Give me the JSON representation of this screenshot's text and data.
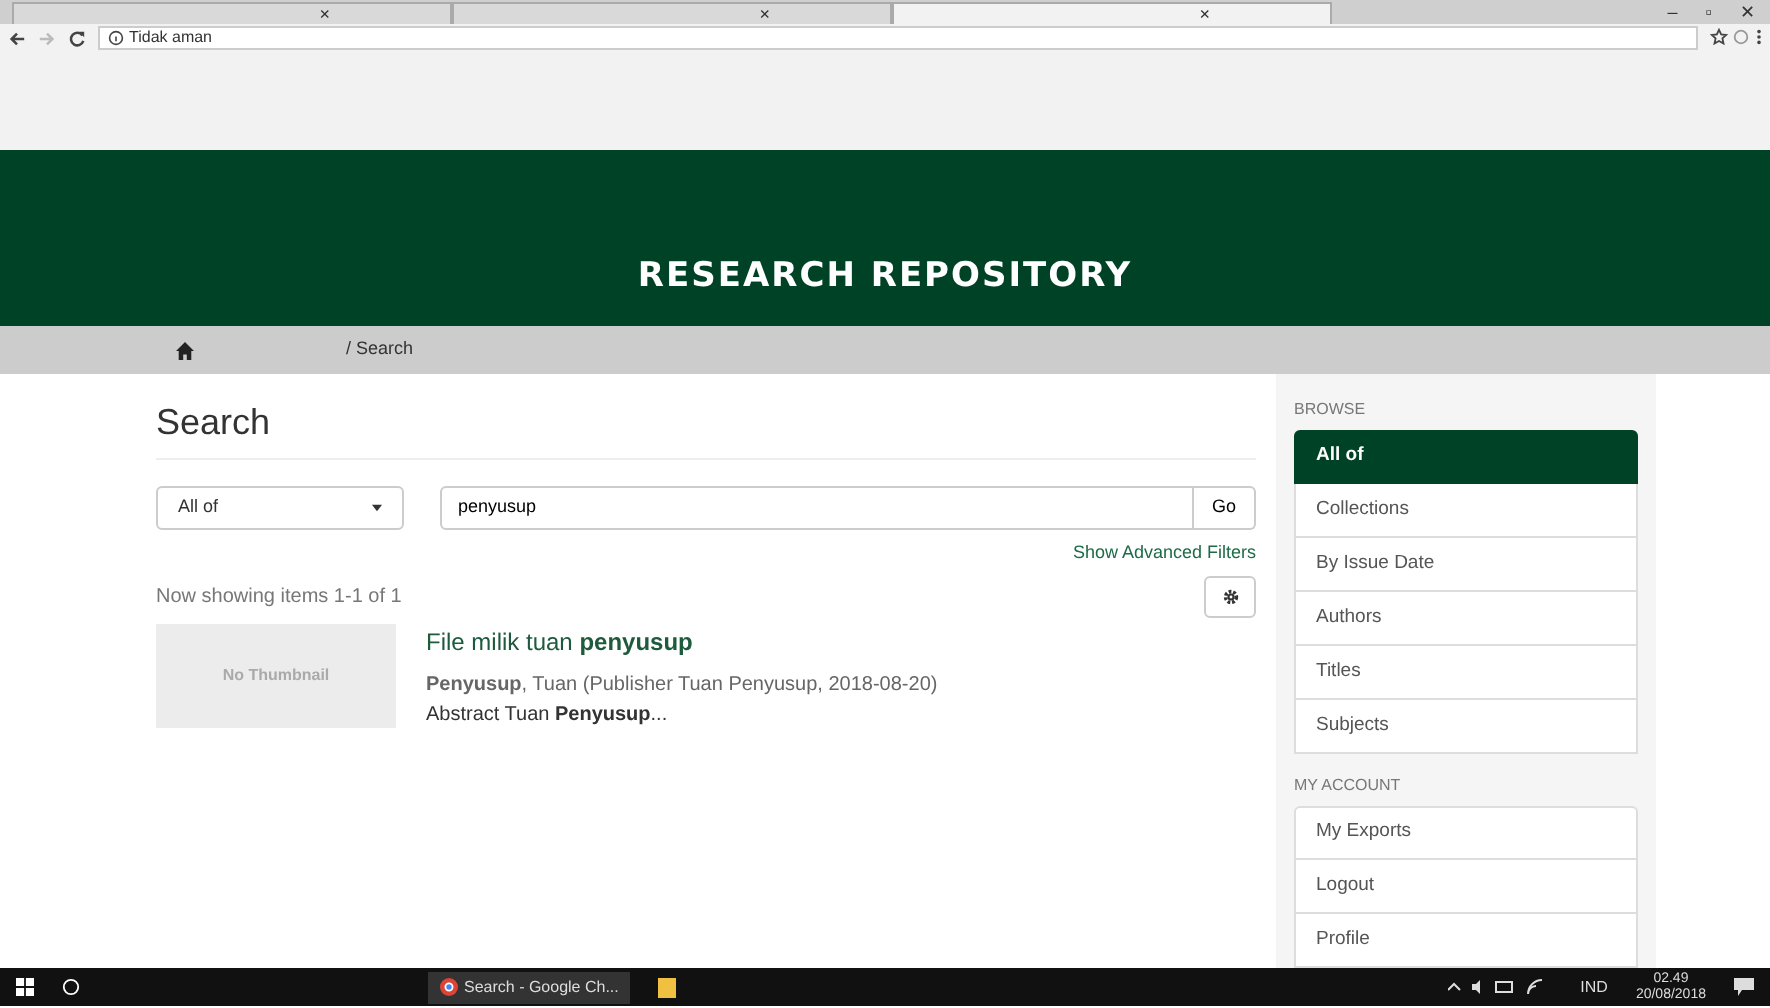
{
  "browser": {
    "tabs": [
      {
        "label": "×",
        "selected": false
      },
      {
        "label": "×",
        "selected": false
      },
      {
        "label": "×",
        "selected": true
      }
    ],
    "window_buttons": [
      "–",
      "▫",
      "✕"
    ],
    "address": "Tidak aman"
  },
  "banner": {
    "title": "RESEARCH REPOSITORY"
  },
  "breadcrumb": [
    "/ Search"
  ],
  "page_title": "Search",
  "search": {
    "scope": "All of",
    "query": "penyusup",
    "go": "Go",
    "advanced": "Show Advanced Filters"
  },
  "results": {
    "count": "Now showing items 1-1 of 1",
    "items": [
      {
        "thumbnail": "No Thumbnail",
        "title": "File milik tuan **penyusup**",
        "meta": "**Penyusup**, Tuan (Publisher Tuan Penyusup, 2018-08-20)",
        "abstract": "Abstract Tuan **Penyusup**..."
      }
    ]
  },
  "sidebar": {
    "sections": [
      {
        "heading": "BROWSE",
        "items": [
          {
            "label": "All of",
            "selected": true
          },
          {
            "label": "Collections",
            "selected": false
          },
          {
            "label": "By Issue Date",
            "selected": false
          },
          {
            "label": "Authors",
            "selected": false
          },
          {
            "label": "Titles",
            "selected": false
          },
          {
            "label": "Subjects",
            "selected": false
          }
        ]
      },
      {
        "heading": "MY ACCOUNT",
        "items": [
          {
            "label": "My Exports",
            "selected": false
          },
          {
            "label": "Logout",
            "selected": false
          },
          {
            "label": "Profile",
            "selected": false
          }
        ]
      }
    ]
  },
  "taskbar": {
    "app": "Search - Google Ch...",
    "language": "IND",
    "time": "02.49",
    "date": "20/08/2018"
  }
}
